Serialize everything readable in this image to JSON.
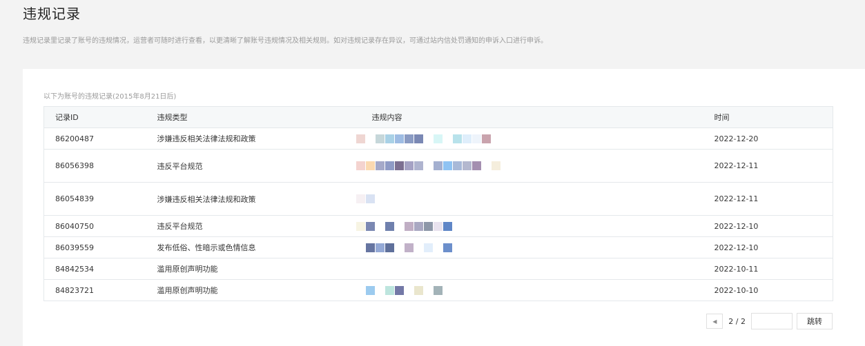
{
  "page": {
    "title": "违规记录",
    "description": "违规记录里记录了账号的违规情况，运营者可随时进行查看，以更清晰了解账号违规情况及相关规则。如对违规记录存在异议，可通过站内信处罚通知的申诉入口进行申诉。"
  },
  "table": {
    "caption": "以下为账号的违规记录(2015年8月21日后)",
    "headers": {
      "id": "记录ID",
      "type": "违规类型",
      "content": "违规内容",
      "time": "时间"
    },
    "rows": [
      {
        "id": "86200487",
        "type": "涉嫌违反相关法律法规和政策",
        "time": "2022-12-20",
        "content_pixels": [
          "#efd6d2",
          "#ffffff",
          "#c6d7da",
          "#a9d1e6",
          "#9ebce3",
          "#8a9bc3",
          "#7a88b4",
          "#ffffff",
          "#d8f6f6",
          "#ffffff",
          "#b8e2eb",
          "#dfeefb",
          "#eef4fb",
          "#c9a3ad"
        ]
      },
      {
        "id": "86056398",
        "type": "违反平台规范",
        "time": "2022-12-11",
        "content_pixels": [
          "#f4d3cf",
          "#fbd9b0",
          "#a5a9c9",
          "#8f9bc6",
          "#7c6f91",
          "#a5a2c4",
          "#afb4cf",
          "#ffffff",
          "#a4b0d0",
          "#8fc3f3",
          "#a8b9d8",
          "#b4b8cf",
          "#a48fb0",
          "#ffffff",
          "#f5eedd"
        ]
      },
      {
        "id": "86054839",
        "type": "涉嫌违反相关法律法规和政策",
        "time": "2022-12-11",
        "content_pixels": [
          "#f6f0f3",
          "#d9e2f3"
        ]
      },
      {
        "id": "86040750",
        "type": "违反平台规范",
        "time": "2022-12-10",
        "content_pixels": [
          "#f7f4e3",
          "#7b88b2",
          "#ffffff",
          "#6f80ad",
          "#ffffff",
          "#c0aec4",
          "#a9a8c2",
          "#8d97a8",
          "#e8e2ee",
          "#5f86c7"
        ]
      },
      {
        "id": "86039559",
        "type": "发布低俗、性暗示或色情信息",
        "time": "2022-12-10",
        "content_pixels": [
          "#ffffff",
          "#6675a1",
          "#94a9d6",
          "#5f709b",
          "#ffffff",
          "#c1b1c8",
          "#ffffff",
          "#e2eefb",
          "#ffffff",
          "#6c8fcb"
        ]
      },
      {
        "id": "84842534",
        "type": "滥用原创声明功能",
        "time": "2022-10-11",
        "content_pixels": []
      },
      {
        "id": "84823721",
        "type": "滥用原创声明功能",
        "time": "2022-10-10",
        "content_pixels": [
          "#ffffff",
          "#9ccbef",
          "#ffffff",
          "#bde5de",
          "#7378a6",
          "#ffffff",
          "#eae6cd",
          "#ffffff",
          "#a3b3b8"
        ]
      }
    ]
  },
  "pager": {
    "prev_icon": "chevron-left-icon",
    "page_info": "2 / 2",
    "input_value": "",
    "jump_label": "跳转"
  }
}
